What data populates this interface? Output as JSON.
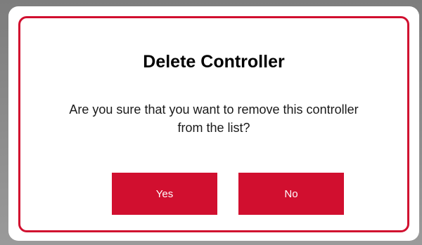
{
  "dialog": {
    "title": "Delete Controller",
    "message": "Are you sure that you want to remove this controller from the list?",
    "yes_label": "Yes",
    "no_label": "No"
  },
  "colors": {
    "accent": "#d10f2f",
    "background": "#ffffff"
  }
}
